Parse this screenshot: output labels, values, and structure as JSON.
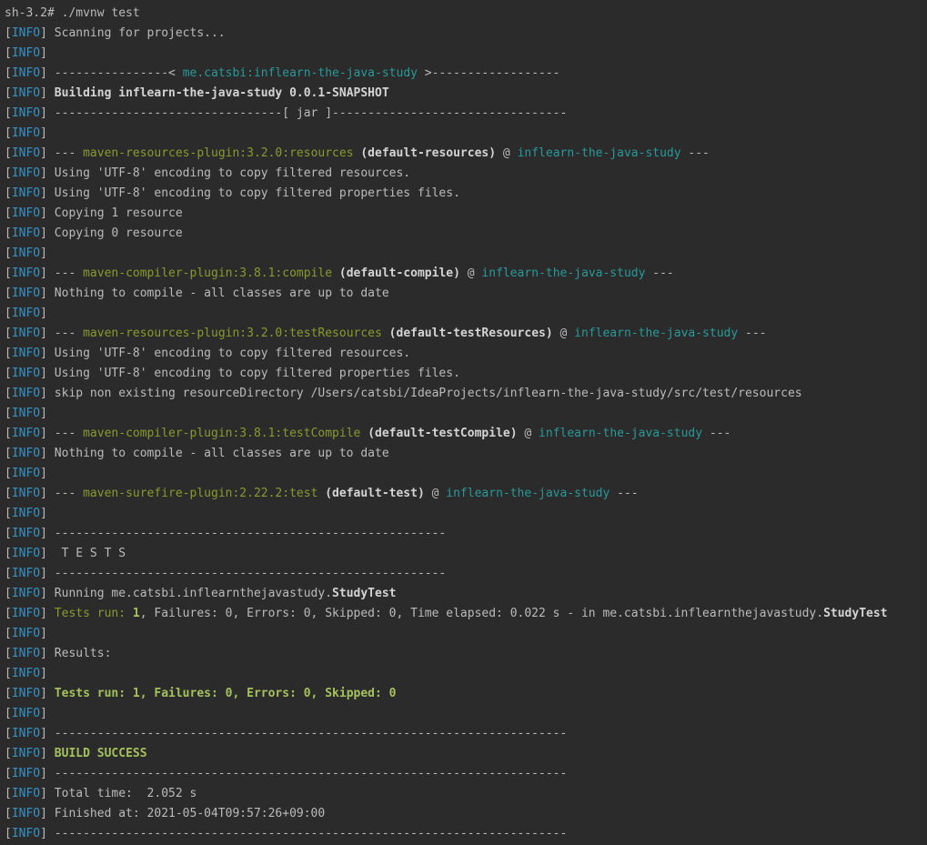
{
  "colors": {
    "background": "#2b2b2b",
    "text": "#bbbbbb",
    "info_tag": "#3592c4",
    "artifact": "#299999",
    "plugin": "#8a9a2e",
    "success": "#a5c25c"
  },
  "terminal": {
    "lines": [
      {
        "segments": [
          {
            "t": "sh-3.2# ./mvnw test",
            "s": "plain"
          }
        ]
      },
      {
        "segments": [
          {
            "t": "[",
            "s": "plain"
          },
          {
            "t": "INFO",
            "s": "info"
          },
          {
            "t": "] Scanning for projects...",
            "s": "plain"
          }
        ]
      },
      {
        "segments": [
          {
            "t": "[",
            "s": "plain"
          },
          {
            "t": "INFO",
            "s": "info"
          },
          {
            "t": "]",
            "s": "plain"
          }
        ]
      },
      {
        "segments": [
          {
            "t": "[",
            "s": "plain"
          },
          {
            "t": "INFO",
            "s": "info"
          },
          {
            "t": "] ----------------< ",
            "s": "plain"
          },
          {
            "t": "me.catsbi:inflearn-the-java-study",
            "s": "cyan"
          },
          {
            "t": " >------------------",
            "s": "plain"
          }
        ]
      },
      {
        "segments": [
          {
            "t": "[",
            "s": "plain"
          },
          {
            "t": "INFO",
            "s": "info"
          },
          {
            "t": "] ",
            "s": "plain"
          },
          {
            "t": "Building inflearn-the-java-study 0.0.1-SNAPSHOT",
            "s": "bold"
          }
        ]
      },
      {
        "segments": [
          {
            "t": "[",
            "s": "plain"
          },
          {
            "t": "INFO",
            "s": "info"
          },
          {
            "t": "] --------------------------------[ jar ]---------------------------------",
            "s": "plain"
          }
        ]
      },
      {
        "segments": [
          {
            "t": "[",
            "s": "plain"
          },
          {
            "t": "INFO",
            "s": "info"
          },
          {
            "t": "]",
            "s": "plain"
          }
        ]
      },
      {
        "segments": [
          {
            "t": "[",
            "s": "plain"
          },
          {
            "t": "INFO",
            "s": "info"
          },
          {
            "t": "] --- ",
            "s": "plain"
          },
          {
            "t": "maven-resources-plugin:3.2.0:resources",
            "s": "green"
          },
          {
            "t": " ",
            "s": "plain"
          },
          {
            "t": "(default-resources)",
            "s": "bold"
          },
          {
            "t": " @ ",
            "s": "plain"
          },
          {
            "t": "inflearn-the-java-study",
            "s": "cyan"
          },
          {
            "t": " ---",
            "s": "plain"
          }
        ]
      },
      {
        "segments": [
          {
            "t": "[",
            "s": "plain"
          },
          {
            "t": "INFO",
            "s": "info"
          },
          {
            "t": "] Using 'UTF-8' encoding to copy filtered resources.",
            "s": "plain"
          }
        ]
      },
      {
        "segments": [
          {
            "t": "[",
            "s": "plain"
          },
          {
            "t": "INFO",
            "s": "info"
          },
          {
            "t": "] Using 'UTF-8' encoding to copy filtered properties files.",
            "s": "plain"
          }
        ]
      },
      {
        "segments": [
          {
            "t": "[",
            "s": "plain"
          },
          {
            "t": "INFO",
            "s": "info"
          },
          {
            "t": "] Copying 1 resource",
            "s": "plain"
          }
        ]
      },
      {
        "segments": [
          {
            "t": "[",
            "s": "plain"
          },
          {
            "t": "INFO",
            "s": "info"
          },
          {
            "t": "] Copying 0 resource",
            "s": "plain"
          }
        ]
      },
      {
        "segments": [
          {
            "t": "[",
            "s": "plain"
          },
          {
            "t": "INFO",
            "s": "info"
          },
          {
            "t": "]",
            "s": "plain"
          }
        ]
      },
      {
        "segments": [
          {
            "t": "[",
            "s": "plain"
          },
          {
            "t": "INFO",
            "s": "info"
          },
          {
            "t": "] --- ",
            "s": "plain"
          },
          {
            "t": "maven-compiler-plugin:3.8.1:compile",
            "s": "green"
          },
          {
            "t": " ",
            "s": "plain"
          },
          {
            "t": "(default-compile)",
            "s": "bold"
          },
          {
            "t": " @ ",
            "s": "plain"
          },
          {
            "t": "inflearn-the-java-study",
            "s": "cyan"
          },
          {
            "t": " ---",
            "s": "plain"
          }
        ]
      },
      {
        "segments": [
          {
            "t": "[",
            "s": "plain"
          },
          {
            "t": "INFO",
            "s": "info"
          },
          {
            "t": "] Nothing to compile - all classes are up to date",
            "s": "plain"
          }
        ]
      },
      {
        "segments": [
          {
            "t": "[",
            "s": "plain"
          },
          {
            "t": "INFO",
            "s": "info"
          },
          {
            "t": "]",
            "s": "plain"
          }
        ]
      },
      {
        "segments": [
          {
            "t": "[",
            "s": "plain"
          },
          {
            "t": "INFO",
            "s": "info"
          },
          {
            "t": "] --- ",
            "s": "plain"
          },
          {
            "t": "maven-resources-plugin:3.2.0:testResources",
            "s": "green"
          },
          {
            "t": " ",
            "s": "plain"
          },
          {
            "t": "(default-testResources)",
            "s": "bold"
          },
          {
            "t": " @ ",
            "s": "plain"
          },
          {
            "t": "inflearn-the-java-study",
            "s": "cyan"
          },
          {
            "t": " ---",
            "s": "plain"
          }
        ]
      },
      {
        "segments": [
          {
            "t": "[",
            "s": "plain"
          },
          {
            "t": "INFO",
            "s": "info"
          },
          {
            "t": "] Using 'UTF-8' encoding to copy filtered resources.",
            "s": "plain"
          }
        ]
      },
      {
        "segments": [
          {
            "t": "[",
            "s": "plain"
          },
          {
            "t": "INFO",
            "s": "info"
          },
          {
            "t": "] Using 'UTF-8' encoding to copy filtered properties files.",
            "s": "plain"
          }
        ]
      },
      {
        "segments": [
          {
            "t": "[",
            "s": "plain"
          },
          {
            "t": "INFO",
            "s": "info"
          },
          {
            "t": "] skip non existing resourceDirectory /Users/catsbi/IdeaProjects/inflearn-the-java-study/src/test/resources",
            "s": "plain"
          }
        ]
      },
      {
        "segments": [
          {
            "t": "[",
            "s": "plain"
          },
          {
            "t": "INFO",
            "s": "info"
          },
          {
            "t": "]",
            "s": "plain"
          }
        ]
      },
      {
        "segments": [
          {
            "t": "[",
            "s": "plain"
          },
          {
            "t": "INFO",
            "s": "info"
          },
          {
            "t": "] --- ",
            "s": "plain"
          },
          {
            "t": "maven-compiler-plugin:3.8.1:testCompile",
            "s": "green"
          },
          {
            "t": " ",
            "s": "plain"
          },
          {
            "t": "(default-testCompile)",
            "s": "bold"
          },
          {
            "t": " @ ",
            "s": "plain"
          },
          {
            "t": "inflearn-the-java-study",
            "s": "cyan"
          },
          {
            "t": " ---",
            "s": "plain"
          }
        ]
      },
      {
        "segments": [
          {
            "t": "[",
            "s": "plain"
          },
          {
            "t": "INFO",
            "s": "info"
          },
          {
            "t": "] Nothing to compile - all classes are up to date",
            "s": "plain"
          }
        ]
      },
      {
        "segments": [
          {
            "t": "[",
            "s": "plain"
          },
          {
            "t": "INFO",
            "s": "info"
          },
          {
            "t": "]",
            "s": "plain"
          }
        ]
      },
      {
        "segments": [
          {
            "t": "[",
            "s": "plain"
          },
          {
            "t": "INFO",
            "s": "info"
          },
          {
            "t": "] --- ",
            "s": "plain"
          },
          {
            "t": "maven-surefire-plugin:2.22.2:test",
            "s": "green"
          },
          {
            "t": " ",
            "s": "plain"
          },
          {
            "t": "(default-test)",
            "s": "bold"
          },
          {
            "t": " @ ",
            "s": "plain"
          },
          {
            "t": "inflearn-the-java-study",
            "s": "cyan"
          },
          {
            "t": " ---",
            "s": "plain"
          }
        ]
      },
      {
        "segments": [
          {
            "t": "[",
            "s": "plain"
          },
          {
            "t": "INFO",
            "s": "info"
          },
          {
            "t": "]",
            "s": "plain"
          }
        ]
      },
      {
        "segments": [
          {
            "t": "[",
            "s": "plain"
          },
          {
            "t": "INFO",
            "s": "info"
          },
          {
            "t": "] -------------------------------------------------------",
            "s": "plain"
          }
        ]
      },
      {
        "segments": [
          {
            "t": "[",
            "s": "plain"
          },
          {
            "t": "INFO",
            "s": "info"
          },
          {
            "t": "]  T E S T S",
            "s": "plain"
          }
        ]
      },
      {
        "segments": [
          {
            "t": "[",
            "s": "plain"
          },
          {
            "t": "INFO",
            "s": "info"
          },
          {
            "t": "] -------------------------------------------------------",
            "s": "plain"
          }
        ]
      },
      {
        "segments": [
          {
            "t": "[",
            "s": "plain"
          },
          {
            "t": "INFO",
            "s": "info"
          },
          {
            "t": "] Running me.catsbi.inflearnthejavastudy.",
            "s": "plain"
          },
          {
            "t": "StudyTest",
            "s": "bold"
          }
        ]
      },
      {
        "segments": [
          {
            "t": "[",
            "s": "plain"
          },
          {
            "t": "INFO",
            "s": "info"
          },
          {
            "t": "] ",
            "s": "plain"
          },
          {
            "t": "Tests run: ",
            "s": "green"
          },
          {
            "t": "1",
            "s": "green-bold"
          },
          {
            "t": ", Failures: 0, Errors: 0, Skipped: 0, Time elapsed: 0.022 s - in me.catsbi.inflearnthejavastudy.",
            "s": "plain"
          },
          {
            "t": "StudyTest",
            "s": "bold"
          }
        ]
      },
      {
        "segments": [
          {
            "t": "[",
            "s": "plain"
          },
          {
            "t": "INFO",
            "s": "info"
          },
          {
            "t": "]",
            "s": "plain"
          }
        ]
      },
      {
        "segments": [
          {
            "t": "[",
            "s": "plain"
          },
          {
            "t": "INFO",
            "s": "info"
          },
          {
            "t": "] Results:",
            "s": "plain"
          }
        ]
      },
      {
        "segments": [
          {
            "t": "[",
            "s": "plain"
          },
          {
            "t": "INFO",
            "s": "info"
          },
          {
            "t": "]",
            "s": "plain"
          }
        ]
      },
      {
        "segments": [
          {
            "t": "[",
            "s": "plain"
          },
          {
            "t": "INFO",
            "s": "info"
          },
          {
            "t": "] ",
            "s": "plain"
          },
          {
            "t": "Tests run: 1, Failures: 0, Errors: 0, Skipped: 0",
            "s": "green-bold"
          }
        ]
      },
      {
        "segments": [
          {
            "t": "[",
            "s": "plain"
          },
          {
            "t": "INFO",
            "s": "info"
          },
          {
            "t": "]",
            "s": "plain"
          }
        ]
      },
      {
        "segments": [
          {
            "t": "[",
            "s": "plain"
          },
          {
            "t": "INFO",
            "s": "info"
          },
          {
            "t": "] ------------------------------------------------------------------------",
            "s": "plain"
          }
        ]
      },
      {
        "segments": [
          {
            "t": "[",
            "s": "plain"
          },
          {
            "t": "INFO",
            "s": "info"
          },
          {
            "t": "] ",
            "s": "plain"
          },
          {
            "t": "BUILD SUCCESS",
            "s": "green-bold"
          }
        ]
      },
      {
        "segments": [
          {
            "t": "[",
            "s": "plain"
          },
          {
            "t": "INFO",
            "s": "info"
          },
          {
            "t": "] ------------------------------------------------------------------------",
            "s": "plain"
          }
        ]
      },
      {
        "segments": [
          {
            "t": "[",
            "s": "plain"
          },
          {
            "t": "INFO",
            "s": "info"
          },
          {
            "t": "] Total time:  2.052 s",
            "s": "plain"
          }
        ]
      },
      {
        "segments": [
          {
            "t": "[",
            "s": "plain"
          },
          {
            "t": "INFO",
            "s": "info"
          },
          {
            "t": "] Finished at: 2021-05-04T09:57:26+09:00",
            "s": "plain"
          }
        ]
      },
      {
        "segments": [
          {
            "t": "[",
            "s": "plain"
          },
          {
            "t": "INFO",
            "s": "info"
          },
          {
            "t": "] ------------------------------------------------------------------------",
            "s": "plain"
          }
        ]
      }
    ]
  }
}
